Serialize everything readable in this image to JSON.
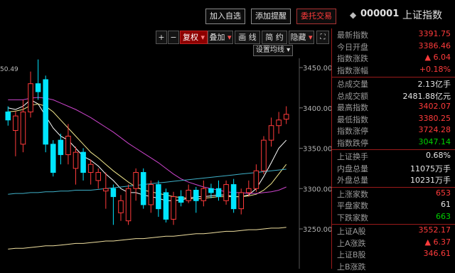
{
  "toolbar": {
    "add_watch": "加入自选",
    "add_alert": "添加提醒",
    "trade": "委托交易",
    "stock_code": "000001",
    "stock_name": "上证指数"
  },
  "chart_controls": {
    "plus": "+",
    "minus": "−",
    "adjust": "复权",
    "overlay": "叠加",
    "draw": "画 线",
    "summary": "简 约",
    "hide": "隐藏",
    "ma_setting": "设置均线",
    "top_label": "50.49"
  },
  "axis": {
    "y_labels": [
      "3450.00",
      "3400.00",
      "3350.00",
      "3300.00",
      "3250.00"
    ]
  },
  "colors": {
    "up": "#ff3b3b",
    "down": "#00e5ff",
    "ma5": "#ffffff",
    "ma10": "#f0e68c",
    "ma20": "#cc44cc",
    "ma60": "#3fb0c8",
    "ma120": "#f0e0a0"
  },
  "chart_data": {
    "type": "candlestick",
    "ylim": [
      3210,
      3480
    ],
    "candles": [
      {
        "o": 3395,
        "c": 3385,
        "h": 3402,
        "l": 3378,
        "up": false
      },
      {
        "o": 3372,
        "c": 3390,
        "h": 3396,
        "l": 3340,
        "up": true
      },
      {
        "o": 3355,
        "c": 3395,
        "h": 3410,
        "l": 3345,
        "up": true
      },
      {
        "o": 3395,
        "c": 3430,
        "h": 3445,
        "l": 3388,
        "up": true
      },
      {
        "o": 3430,
        "c": 3420,
        "h": 3460,
        "l": 3410,
        "up": false
      },
      {
        "o": 3435,
        "c": 3355,
        "h": 3440,
        "l": 3345,
        "up": false
      },
      {
        "o": 3355,
        "c": 3320,
        "h": 3360,
        "l": 3315,
        "up": false
      },
      {
        "o": 3360,
        "c": 3342,
        "h": 3368,
        "l": 3330,
        "up": false
      },
      {
        "o": 3342,
        "c": 3365,
        "h": 3380,
        "l": 3330,
        "up": true
      },
      {
        "o": 3325,
        "c": 3345,
        "h": 3352,
        "l": 3305,
        "up": true
      },
      {
        "o": 3345,
        "c": 3320,
        "h": 3350,
        "l": 3310,
        "up": false
      },
      {
        "o": 3320,
        "c": 3330,
        "h": 3336,
        "l": 3305,
        "up": true
      },
      {
        "o": 3310,
        "c": 3320,
        "h": 3325,
        "l": 3300,
        "up": true
      },
      {
        "o": 3297,
        "c": 3300,
        "h": 3320,
        "l": 3275,
        "up": true
      },
      {
        "o": 3300,
        "c": 3290,
        "h": 3305,
        "l": 3255,
        "up": false
      },
      {
        "o": 3270,
        "c": 3285,
        "h": 3292,
        "l": 3260,
        "up": true
      },
      {
        "o": 3260,
        "c": 3300,
        "h": 3305,
        "l": 3255,
        "up": true
      },
      {
        "o": 3300,
        "c": 3320,
        "h": 3325,
        "l": 3285,
        "up": true
      },
      {
        "o": 3320,
        "c": 3280,
        "h": 3325,
        "l": 3275,
        "up": false
      },
      {
        "o": 3280,
        "c": 3305,
        "h": 3310,
        "l": 3270,
        "up": true
      },
      {
        "o": 3305,
        "c": 3275,
        "h": 3310,
        "l": 3265,
        "up": false
      },
      {
        "o": 3295,
        "c": 3262,
        "h": 3300,
        "l": 3258,
        "up": false
      },
      {
        "o": 3262,
        "c": 3290,
        "h": 3296,
        "l": 3255,
        "up": true
      },
      {
        "o": 3290,
        "c": 3283,
        "h": 3298,
        "l": 3278,
        "up": false
      },
      {
        "o": 3285,
        "c": 3298,
        "h": 3305,
        "l": 3282,
        "up": true
      },
      {
        "o": 3298,
        "c": 3285,
        "h": 3302,
        "l": 3270,
        "up": false
      },
      {
        "o": 3285,
        "c": 3300,
        "h": 3310,
        "l": 3278,
        "up": true
      },
      {
        "o": 3300,
        "c": 3295,
        "h": 3306,
        "l": 3288,
        "up": false
      },
      {
        "o": 3300,
        "c": 3290,
        "h": 3310,
        "l": 3285,
        "up": false
      },
      {
        "o": 3285,
        "c": 3305,
        "h": 3310,
        "l": 3280,
        "up": true
      },
      {
        "o": 3305,
        "c": 3275,
        "h": 3312,
        "l": 3270,
        "up": false
      },
      {
        "o": 3275,
        "c": 3295,
        "h": 3300,
        "l": 3268,
        "up": true
      },
      {
        "o": 3295,
        "c": 3300,
        "h": 3310,
        "l": 3290,
        "up": true
      },
      {
        "o": 3300,
        "c": 3322,
        "h": 3330,
        "l": 3296,
        "up": true
      },
      {
        "o": 3322,
        "c": 3360,
        "h": 3365,
        "l": 3318,
        "up": true
      },
      {
        "o": 3360,
        "c": 3378,
        "h": 3388,
        "l": 3352,
        "up": true
      },
      {
        "o": 3378,
        "c": 3385,
        "h": 3395,
        "l": 3368,
        "up": true
      },
      {
        "o": 3386,
        "c": 3392,
        "h": 3402,
        "l": 3380,
        "up": true
      }
    ],
    "ma_lines": [
      {
        "name": "MA5",
        "values": [
          3400,
          3398,
          3402,
          3410,
          3405,
          3390,
          3375,
          3365,
          3360,
          3350,
          3340,
          3335,
          3328,
          3318,
          3310,
          3300,
          3295,
          3295,
          3292,
          3290,
          3288,
          3285,
          3285,
          3286,
          3288,
          3290,
          3290,
          3291,
          3292,
          3292,
          3290,
          3290,
          3292,
          3300,
          3315,
          3332,
          3350,
          3360
        ]
      },
      {
        "name": "MA10",
        "values": [
          3395,
          3396,
          3398,
          3403,
          3405,
          3402,
          3395,
          3385,
          3375,
          3365,
          3355,
          3345,
          3338,
          3330,
          3322,
          3315,
          3308,
          3302,
          3298,
          3296,
          3294,
          3292,
          3290,
          3289,
          3288,
          3287,
          3288,
          3289,
          3290,
          3290,
          3290,
          3290,
          3291,
          3293,
          3298,
          3306,
          3318,
          3330
        ]
      },
      {
        "name": "MA20",
        "values": [
          3410,
          3410,
          3410,
          3412,
          3413,
          3412,
          3410,
          3406,
          3402,
          3398,
          3393,
          3388,
          3382,
          3376,
          3370,
          3363,
          3356,
          3350,
          3344,
          3338,
          3332,
          3325,
          3318,
          3312,
          3308,
          3305,
          3302,
          3300,
          3298,
          3296,
          3295,
          3295,
          3294,
          3294,
          3295,
          3296,
          3298,
          3302
        ]
      },
      {
        "name": "MA60",
        "values": [
          3293,
          3294,
          3294,
          3295,
          3295,
          3296,
          3296,
          3297,
          3297,
          3298,
          3298,
          3298,
          3299,
          3300,
          3301,
          3302,
          3303,
          3304,
          3305,
          3306,
          3307,
          3308,
          3309,
          3310,
          3311,
          3312,
          3313,
          3314,
          3315,
          3316,
          3317,
          3318,
          3319,
          3320,
          3321,
          3322,
          3323,
          3324
        ]
      },
      {
        "name": "MA120",
        "values": [
          3225,
          3226,
          3226,
          3227,
          3228,
          3229,
          3229,
          3230,
          3231,
          3232,
          3232,
          3233,
          3234,
          3235,
          3235,
          3236,
          3237,
          3238,
          3238,
          3239,
          3240,
          3241,
          3241,
          3242,
          3243,
          3244,
          3244,
          3245,
          3246,
          3247,
          3247,
          3248,
          3249,
          3249,
          3250,
          3251,
          3251,
          3252
        ]
      }
    ]
  },
  "quote_panel": {
    "rows": [
      {
        "label": "最新指数",
        "value": "3391.75",
        "color": "#ff3b3b"
      },
      {
        "label": "今日开盘",
        "value": "3386.46",
        "color": "#ff3b3b"
      },
      {
        "label": "指数涨跌",
        "value": "▲ 6.04",
        "color": "#ff3b3b"
      },
      {
        "label": "指数涨幅",
        "value": "+0.18%",
        "color": "#ff3b3b"
      },
      {
        "label": "总成交量",
        "value": "2.13亿手",
        "color": "#e6e6e6"
      },
      {
        "label": "总成交额",
        "value": "2481.88亿元",
        "color": "#e6e6e6"
      },
      {
        "label": "最高指数",
        "value": "3402.07",
        "color": "#ff3b3b"
      },
      {
        "label": "最低指数",
        "value": "3380.25",
        "color": "#ff3b3b"
      },
      {
        "label": "指数涨停",
        "value": "3724.28",
        "color": "#ff3b3b"
      },
      {
        "label": "指数跌停",
        "value": "3047.14",
        "color": "#00d000"
      },
      {
        "label": "上证换手",
        "value": "0.68%",
        "color": "#e6e6e6"
      },
      {
        "label": "内盘总量",
        "value": "11075万手",
        "color": "#e6e6e6"
      },
      {
        "label": "外盘总量",
        "value": "10231万手",
        "color": "#e6e6e6"
      },
      {
        "label": "上涨家数",
        "value": "653",
        "color": "#ff3b3b"
      },
      {
        "label": "平盘家数",
        "value": "61",
        "color": "#e6e6e6"
      },
      {
        "label": "下跌家数",
        "value": "663",
        "color": "#00d000"
      },
      {
        "label": "上证A股",
        "value": "3552.17",
        "color": "#ff3b3b"
      },
      {
        "label": "上A涨跌",
        "value": "▲ 6.37",
        "color": "#ff3b3b"
      },
      {
        "label": "上证B股",
        "value": "346.61",
        "color": "#ff3b3b"
      },
      {
        "label": "上B涨跌",
        "value": "",
        "color": "#ff3b3b"
      }
    ]
  }
}
